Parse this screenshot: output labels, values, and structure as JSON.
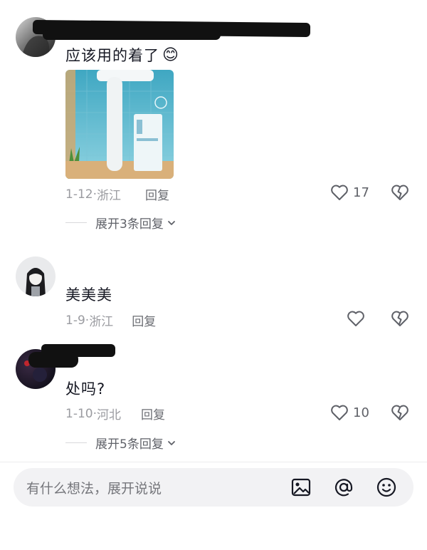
{
  "comments": [
    {
      "text": "应该用的着了",
      "emoji": "😊",
      "date": "1-12",
      "location": "浙江",
      "reply_label": "回复",
      "likes": "17",
      "expand_label": "展开3条回复"
    },
    {
      "text": "美美美",
      "date": "1-9",
      "location": "浙江",
      "reply_label": "回复",
      "likes": "",
      "expand_label": ""
    },
    {
      "text": "处吗?",
      "date": "1-10",
      "location": "河北",
      "reply_label": "回复",
      "likes": "10",
      "expand_label": "展开5条回复"
    }
  ],
  "input": {
    "placeholder": "有什么想法，展开说说"
  },
  "icons": {
    "like": "heart-outline-icon",
    "dislike": "broken-heart-icon",
    "image": "image-icon",
    "mention": "at-icon",
    "emoji": "smiley-icon",
    "chevron": "chevron-down-icon"
  },
  "colors": {
    "text": "#161823",
    "meta": "#9a9ba0",
    "input_bg": "#f2f2f4"
  }
}
